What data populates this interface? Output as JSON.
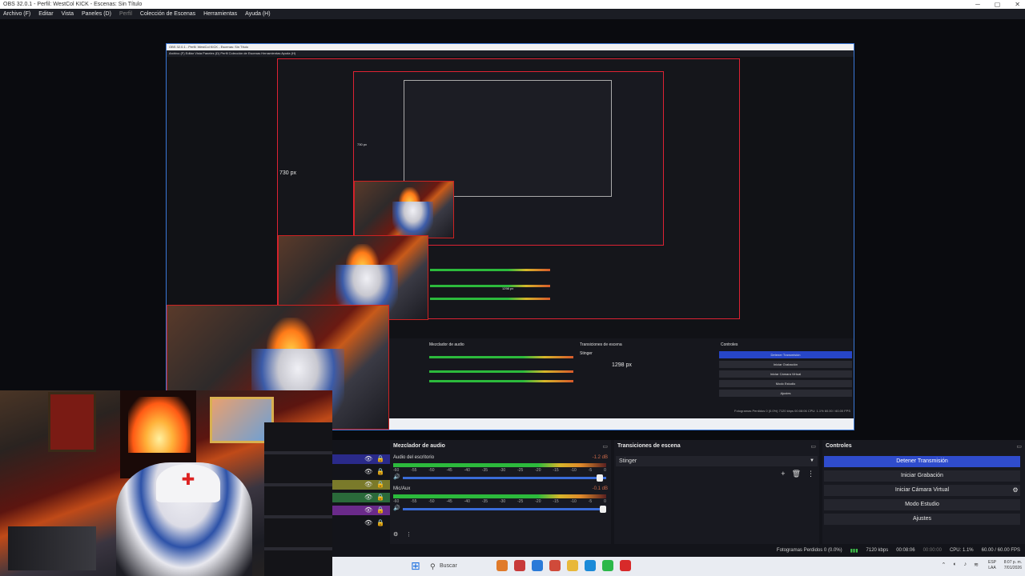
{
  "window": {
    "title": "OBS 32.0.1 - Perfil: WestCol KICK - Escenas: Sin Título",
    "controls": [
      "─",
      "▢",
      "✕"
    ]
  },
  "menu": {
    "items": [
      "Archivo (F)",
      "Editar",
      "Vista",
      "Paneles (D)"
    ],
    "profile": "Perfil",
    "items2": [
      "Colección de Escenas",
      "Herramientas",
      "Ayuda (H)"
    ]
  },
  "preview": {
    "nested_title": "OBS 32.0.1 - Perfil: WestCol KICK - Escenas: Sin Título",
    "nested_menu": "Archivo (F)   Editar   Vista   Paneles (D)   Perfil   Colección de Escenas   Herramientas   Ayuda (H)",
    "label_730": "730 px",
    "label_1298": "1298 px",
    "label_730_small": "730 px",
    "label_1298_small": "1298 px",
    "mixer_hdr": "Mezclador de audio",
    "trans_hdr": "Transiciones de escena",
    "ctrl_hdr": "Controles",
    "ctrl_btns": [
      "Detener Transmisión",
      "Iniciar Grabación",
      "Iniciar Cámara Virtual",
      "Modo Estudio",
      "Ajustes"
    ],
    "stinger": "Stinger",
    "mini_status": "Fotogramas Perdidos 0 (0.0%)   7120 kbps   00:08:06   CPU: 1.1%   60.00 / 60.00 FPS"
  },
  "mixer": {
    "title": "Mezclador de audio",
    "sources": [
      {
        "name": "Audio del escritorio",
        "db": "-1.2 dB"
      },
      {
        "name": "Mic/Aux",
        "db": "-0.1 dB"
      }
    ],
    "scale": [
      "-60",
      "-55",
      "-50",
      "-45",
      "-40",
      "-35",
      "-30",
      "-25",
      "-20",
      "-15",
      "-10",
      "-5",
      "0"
    ],
    "volume_icon": "🔊",
    "menu_icon": "⋮",
    "gear_icon": "⚙"
  },
  "transitions": {
    "title": "Transiciones de escena",
    "selected": "Stinger",
    "add": "+",
    "delete": "🗑",
    "more": "⋮"
  },
  "controls": {
    "title": "Controles",
    "buttons": [
      "Detener Transmisión",
      "Iniciar Grabación",
      "Iniciar Cámara Virtual",
      "Modo Estudio",
      "Ajustes"
    ]
  },
  "status": {
    "dropped": "Fotogramas Perdidos 0 (0.0%)",
    "bitrate": "7120 kbps",
    "stream_time": "00:08:06",
    "rec_time": "00:00:00",
    "cpu": "CPU: 1.1%",
    "fps": "60.00 / 60.00 FPS"
  },
  "taskbar": {
    "search": "Buscar",
    "lang1": "ESP",
    "lang2": "LAA",
    "time": "8:07 p. m.",
    "date": "7/01/2026",
    "app_colors": [
      "#e07a2a",
      "#c83a3a",
      "#2a7ad8",
      "#d04a3a",
      "#e8b83a",
      "#1a8ad8",
      "#2cb84a",
      "#d82a2a"
    ]
  },
  "colors": {
    "accent_blue": "#2f4ccc",
    "meter_green": "#2cba3c",
    "border_red": "#dd2233",
    "preview_border": "#3a78d8"
  }
}
